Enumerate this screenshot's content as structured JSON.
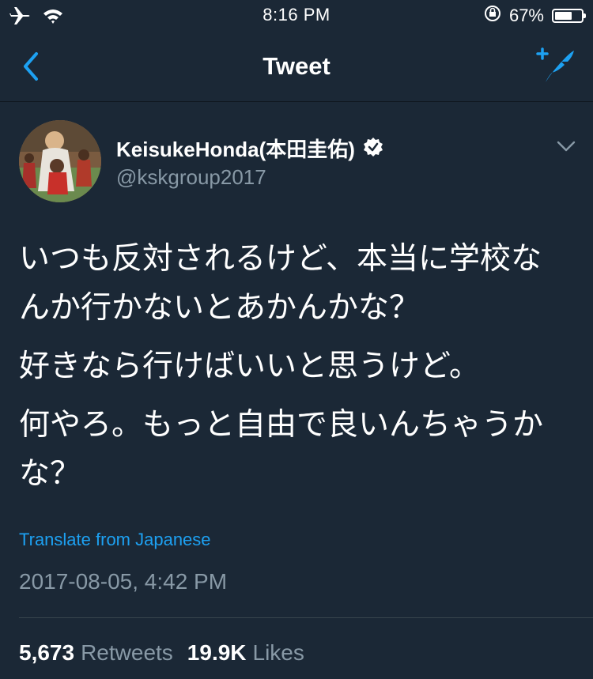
{
  "status_bar": {
    "time": "8:16 PM",
    "battery_percent": "67%",
    "battery_level": 0.67,
    "icons": [
      "airplane-icon",
      "wifi-icon",
      "orientation-lock-icon",
      "battery-icon"
    ]
  },
  "nav": {
    "title": "Tweet",
    "back_icon": "chevron-left-icon",
    "compose_icon": "compose-tweet-icon"
  },
  "tweet": {
    "display_name": "KeisukeHonda(本田圭佑)",
    "verified": true,
    "handle": "@kskgroup2017",
    "paragraphs": [
      "いつも反対されるけど、本当に学校なんか行かないとあかんかな？",
      "好きなら行けばいいと思うけど。",
      "何やろ。もっと自由で良いんちゃうかな？"
    ],
    "translate_label": "Translate from Japanese",
    "timestamp": "2017-08-05, 4:42 PM",
    "retweets_count": "5,673",
    "retweets_label": "Retweets",
    "likes_count": "19.9K",
    "likes_label": "Likes"
  },
  "colors": {
    "background": "#1b2836",
    "accent": "#1da1f2",
    "muted": "#8899a6"
  }
}
